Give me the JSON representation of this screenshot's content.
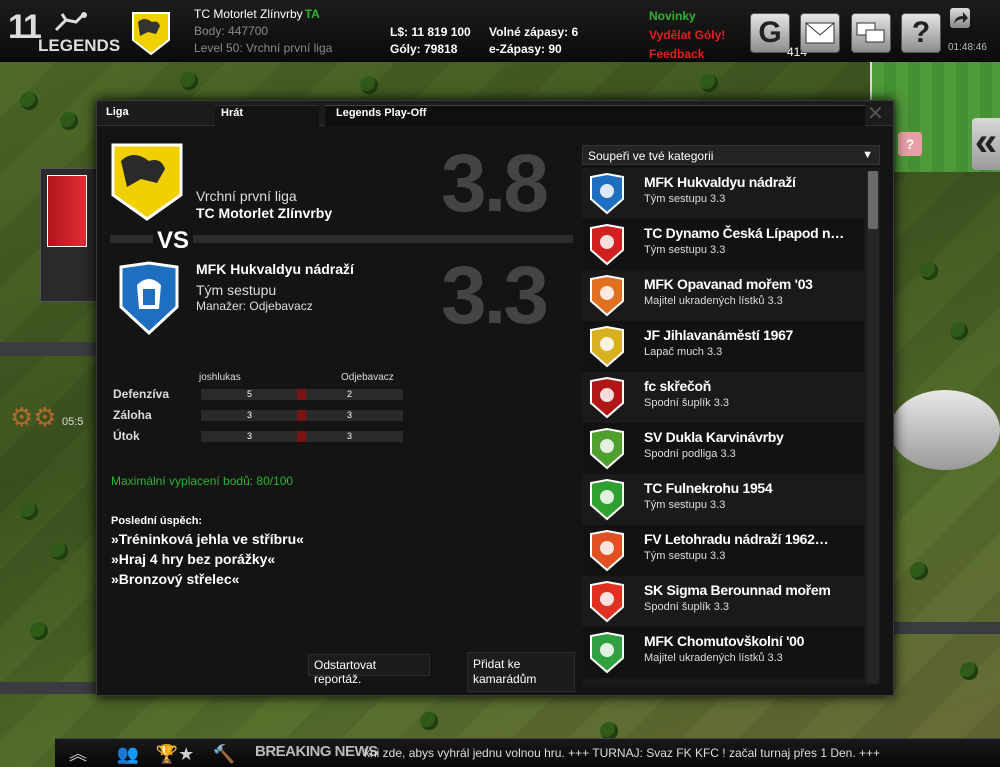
{
  "header": {
    "logo_number": "11",
    "logo_word": "LEGENDS",
    "club_name": "TC Motorlet Zlínvrby",
    "club_tag": "TA",
    "points_line": "Body: 447700",
    "level_line": "Level 50: Vrchní první liga",
    "ls_line": "L$: 11 819 100",
    "goals_line": "Góly: 79818",
    "free_matches_line": "Volné zápasy: 6",
    "ematches_line": "e-Zápasy: 90",
    "news_link": "Novinky",
    "earn_goals_link": "Vydělat Góly!",
    "feedback_link": "Feedback",
    "g_button_label": "G",
    "g_count": "414",
    "help_label": "?",
    "clock": "01:48:46"
  },
  "side": {
    "arrow": "«",
    "gift": "?",
    "left_timer": "05:5"
  },
  "tabs": [
    {
      "label": "Liga"
    },
    {
      "label": "Hrát"
    },
    {
      "label": "Legends Play-Off"
    }
  ],
  "close_label": "✕",
  "match": {
    "home_league": "Vrchní první liga",
    "home_name": "TC Motorlet Zlínvrby",
    "home_rating": "3.8",
    "vs": "VS",
    "away_name": "MFK  Hukvaldyu nádraží",
    "away_sub": "Tým sestupu",
    "away_manager": "Manažer: Odjebavacz",
    "away_rating": "3.3"
  },
  "comparison": {
    "left_name": "joshlukas",
    "right_name": "Odjebavacz",
    "rows": [
      {
        "label": "Defenzíva",
        "left": "5",
        "right": "2"
      },
      {
        "label": "Záloha",
        "left": "3",
        "right": "3"
      },
      {
        "label": "Útok",
        "left": "3",
        "right": "3"
      }
    ]
  },
  "max_points": "Maximální vyplacení bodů: 80/100",
  "achievements": {
    "title": "Poslední úspěch:",
    "items": [
      "»Tréninková jehla ve stříbru«",
      "»Hraj 4 hry bez porážky«",
      "»Bronzový střelec«"
    ]
  },
  "buttons": {
    "report": "Odstartovat reportáž.",
    "add_friend_line1": "Přidat ke",
    "add_friend_line2": "kamarádům"
  },
  "opponents": {
    "select_label": "Soupeři ve tvé kategorii",
    "select_arrow": "▼",
    "items": [
      {
        "name": "MFK  Hukvaldyu nádraží",
        "sub": "Tým sestupu 3.3",
        "color": "#1e6fc0"
      },
      {
        "name": "TC Dynamo Česká Lípapod n…",
        "sub": "Tým sestupu 3.3",
        "color": "#d02020"
      },
      {
        "name": "MFK Opavanad mořem '03",
        "sub": "Majitel ukradených lístků 3.3",
        "color": "#e07020"
      },
      {
        "name": "JF Jihlavanáměstí 1967",
        "sub": "Lapač much 3.3",
        "color": "#d8b020"
      },
      {
        "name": "fc skřečoň",
        "sub": "Spodní šuplík 3.3",
        "color": "#b01818"
      },
      {
        "name": "SV Dukla Karvinávrby",
        "sub": "Spodní podliga 3.3",
        "color": "#50a030"
      },
      {
        "name": "TC Fulnekrohu 1954",
        "sub": "Tým sestupu 3.3",
        "color": "#30a030"
      },
      {
        "name": "FV Letohradu nádraží 1962…",
        "sub": "Tým sestupu 3.3",
        "color": "#e05020"
      },
      {
        "name": "SK Sigma Berounnad mořem",
        "sub": "Spodní šuplík 3.3",
        "color": "#e03020"
      },
      {
        "name": "MFK Chomutovškolní '00",
        "sub": "Majitel ukradených lístků 3.3",
        "color": "#30a040"
      }
    ]
  },
  "bottom": {
    "breaking": "BREAKING NEWS",
    "ticker": "kni zde, abys vyhrál jednu volnou hru.    +++    TURNAJ: Svaz FK KFC ! začal turnaj přes 1 Den.    +++   "
  },
  "colors": {
    "accent_green": "#2bb52b",
    "accent_red": "#e02020",
    "home_badge": "#f0d000",
    "away_badge": "#1e6fc0"
  }
}
